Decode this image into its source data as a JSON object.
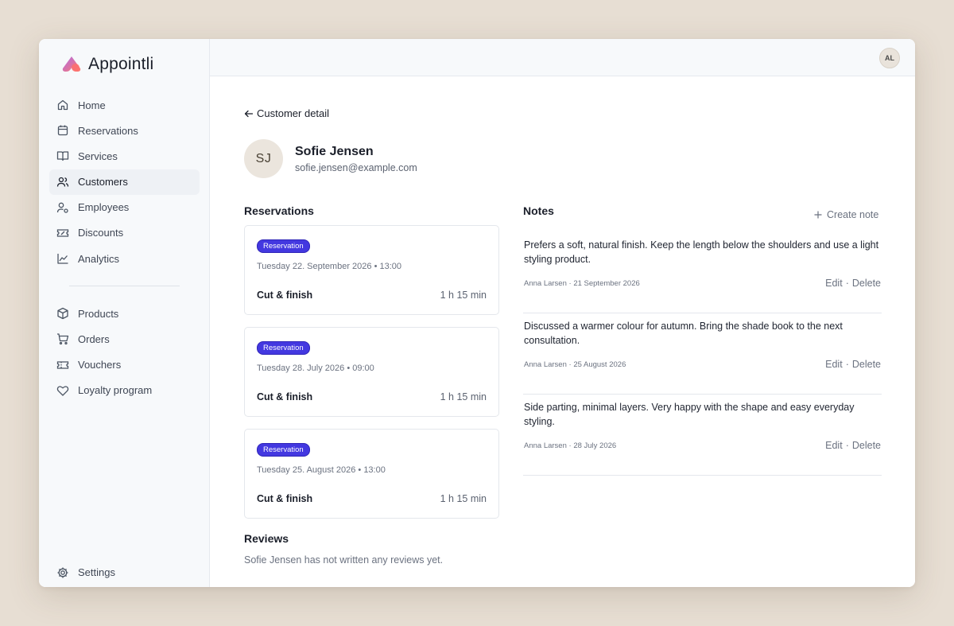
{
  "brand": {
    "name": "Appointli"
  },
  "sidebar": {
    "items": [
      {
        "label": "Home",
        "icon": "home-icon"
      },
      {
        "label": "Reservations",
        "icon": "calendar-icon"
      },
      {
        "label": "Services",
        "icon": "book-icon"
      },
      {
        "label": "Customers",
        "icon": "users-icon",
        "active": true
      },
      {
        "label": "Employees",
        "icon": "user-cog-icon"
      },
      {
        "label": "Discounts",
        "icon": "ticket-icon"
      },
      {
        "label": "Analytics",
        "icon": "chart-line-icon"
      }
    ],
    "items2": [
      {
        "label": "Products",
        "icon": "box-icon"
      },
      {
        "label": "Orders",
        "icon": "cart-icon"
      },
      {
        "label": "Vouchers",
        "icon": "voucher-icon"
      },
      {
        "label": "Loyalty program",
        "icon": "heart-icon"
      }
    ],
    "settings": {
      "label": "Settings",
      "icon": "gear-icon"
    }
  },
  "header": {
    "user_initials": "AL"
  },
  "page": {
    "back_label": "Customer detail",
    "customer": {
      "initials": "SJ",
      "name": "Sofie Jensen",
      "email": "sofie.jensen@example.com"
    },
    "reservations_title": "Reservations",
    "reservations": [
      {
        "badge": "Reservation",
        "date": "Tuesday 22. September 2026 • 13:00",
        "service": "Cut & finish",
        "duration": "1 h 15 min"
      },
      {
        "badge": "Reservation",
        "date": "Tuesday 28. July 2026 • 09:00",
        "service": "Cut & finish",
        "duration": "1 h 15 min"
      },
      {
        "badge": "Reservation",
        "date": "Tuesday 25. August 2026 • 13:00",
        "service": "Cut & finish",
        "duration": "1 h 15 min"
      }
    ],
    "reviews_title": "Reviews",
    "reviews_empty": "Sofie Jensen has not written any reviews yet.",
    "notes_title": "Notes",
    "create_note_label": "Create note",
    "notes": [
      {
        "text": "Prefers a soft, natural finish. Keep the length below the shoulders and use a light styling product.",
        "meta": "Anna Larsen · 21 September 2026",
        "edit": "Edit",
        "sep": "·",
        "delete": "Delete"
      },
      {
        "text": "Discussed a warmer colour for autumn. Bring the shade book to the next consultation.",
        "meta": "Anna Larsen · 25 August 2026",
        "edit": "Edit",
        "sep": "·",
        "delete": "Delete"
      },
      {
        "text": "Side parting, minimal layers. Very happy with the shape and easy everyday styling.",
        "meta": "Anna Larsen · 28 July 2026",
        "edit": "Edit",
        "sep": "·",
        "delete": "Delete"
      }
    ]
  },
  "colors": {
    "accent": "#4338e0",
    "sidebar_bg": "#f7f9fb",
    "backdrop": "#e7ded3"
  }
}
